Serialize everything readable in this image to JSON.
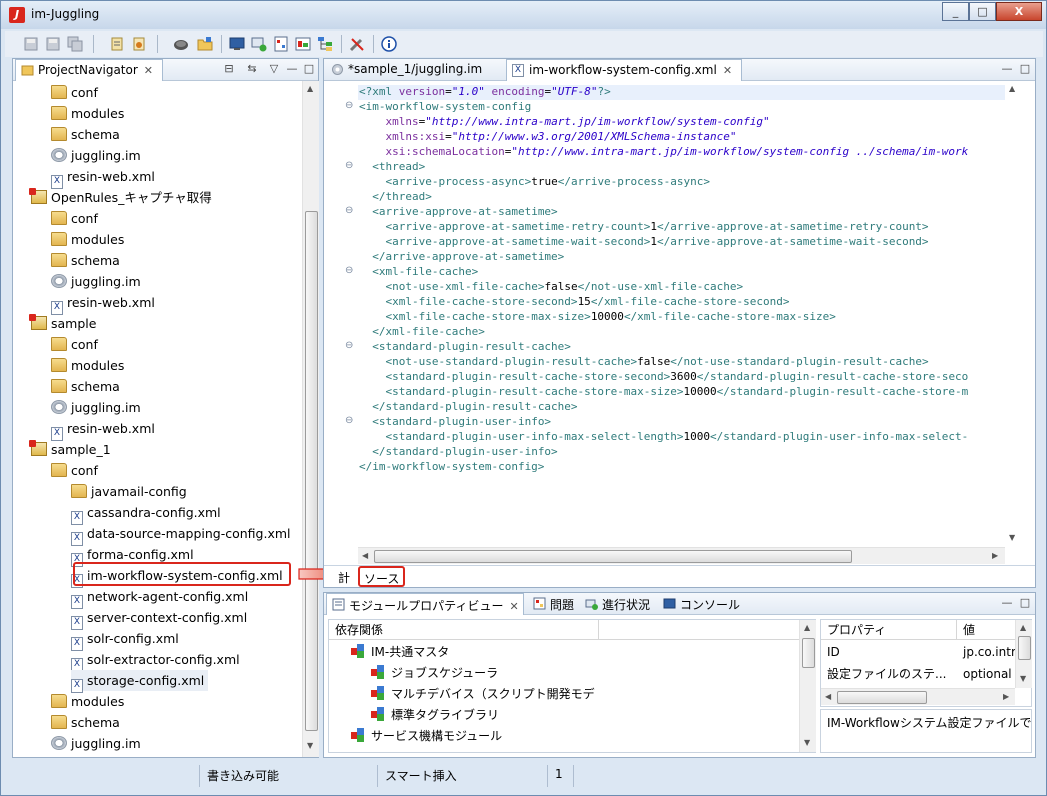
{
  "window": {
    "title": "im-Juggling",
    "buttons": [
      "_",
      "□",
      "X"
    ]
  },
  "navigator": {
    "tab_label": "ProjectNavigator",
    "rows": [
      {
        "label": "conf",
        "icon": "folder-icon"
      },
      {
        "label": "modules",
        "icon": "folder-icon"
      },
      {
        "label": "schema",
        "icon": "folder-icon"
      },
      {
        "label": "juggling.im",
        "icon": "gear-icon"
      },
      {
        "label": "resin-web.xml",
        "icon": "xml-file-icon"
      },
      {
        "label": "OpenRules_キャプチャ取得",
        "icon": "project-icon"
      },
      {
        "label": "conf",
        "icon": "folder-icon"
      },
      {
        "label": "modules",
        "icon": "folder-icon"
      },
      {
        "label": "schema",
        "icon": "folder-icon"
      },
      {
        "label": "juggling.im",
        "icon": "gear-icon"
      },
      {
        "label": "resin-web.xml",
        "icon": "xml-file-icon"
      },
      {
        "label": "sample",
        "icon": "project-icon"
      },
      {
        "label": "conf",
        "icon": "folder-icon"
      },
      {
        "label": "modules",
        "icon": "folder-icon"
      },
      {
        "label": "schema",
        "icon": "folder-icon"
      },
      {
        "label": "juggling.im",
        "icon": "gear-icon"
      },
      {
        "label": "resin-web.xml",
        "icon": "xml-file-icon"
      },
      {
        "label": "sample_1",
        "icon": "project-icon"
      },
      {
        "label": "conf",
        "icon": "folder-icon"
      },
      {
        "label": "javamail-config",
        "icon": "folder-icon"
      },
      {
        "label": "cassandra-config.xml",
        "icon": "xml-file-icon"
      },
      {
        "label": "data-source-mapping-config.xml",
        "icon": "xml-file-icon"
      },
      {
        "label": "forma-config.xml",
        "icon": "xml-file-icon"
      },
      {
        "label": "im-workflow-system-config.xml",
        "icon": "xml-file-icon"
      },
      {
        "label": "network-agent-config.xml",
        "icon": "xml-file-icon"
      },
      {
        "label": "server-context-config.xml",
        "icon": "xml-file-icon"
      },
      {
        "label": "solr-config.xml",
        "icon": "xml-file-icon"
      },
      {
        "label": "solr-extractor-config.xml",
        "icon": "xml-file-icon"
      },
      {
        "label": "storage-config.xml",
        "icon": "xml-file-icon"
      },
      {
        "label": "modules",
        "icon": "folder-icon"
      },
      {
        "label": "schema",
        "icon": "folder-icon"
      },
      {
        "label": "juggling.im",
        "icon": "gear-icon"
      }
    ]
  },
  "editor": {
    "tabs": [
      {
        "label": "*sample_1/juggling.im",
        "active": false
      },
      {
        "label": "im-workflow-system-config.xml",
        "active": true
      }
    ],
    "bottom_tabs": [
      "計",
      "ソース"
    ],
    "code_lines": [
      {
        "fold": "",
        "html": "<span class='tag'>&lt;?xml</span> <span class='attr'>version</span>=<span class='val'>\"1.0\"</span> <span class='attr'>encoding</span>=<span class='val'>\"UTF-8\"</span><span class='tag'>?&gt;</span>"
      },
      {
        "fold": "⊖",
        "html": "<span class='tag'>&lt;im-workflow-system-config</span>"
      },
      {
        "fold": "",
        "html": "    <span class='attr'>xmlns</span>=<span class='val'>\"http://www.intra-mart.jp/im-workflow/system-config\"</span>"
      },
      {
        "fold": "",
        "html": "    <span class='attr'>xmlns:xsi</span>=<span class='val'>\"http://www.w3.org/2001/XMLSchema-instance\"</span>"
      },
      {
        "fold": "",
        "html": "    <span class='attr'>xsi:schemaLocation</span>=<span class='val'>\"http://www.intra-mart.jp/im-workflow/system-config ../schema/im-work</span>"
      },
      {
        "fold": "⊖",
        "html": "  <span class='tag'>&lt;thread&gt;</span>"
      },
      {
        "fold": "",
        "html": "    <span class='tag'>&lt;arrive-process-async&gt;</span>true<span class='tag'>&lt;/arrive-process-async&gt;</span>"
      },
      {
        "fold": "",
        "html": "  <span class='tag'>&lt;/thread&gt;</span>"
      },
      {
        "fold": "⊖",
        "html": "  <span class='tag'>&lt;arrive-approve-at-sametime&gt;</span>"
      },
      {
        "fold": "",
        "html": "    <span class='tag'>&lt;arrive-approve-at-sametime-retry-count&gt;</span>1<span class='tag'>&lt;/arrive-approve-at-sametime-retry-count&gt;</span>"
      },
      {
        "fold": "",
        "html": "    <span class='tag'>&lt;arrive-approve-at-sametime-wait-second&gt;</span>1<span class='tag'>&lt;/arrive-approve-at-sametime-wait-second&gt;</span>"
      },
      {
        "fold": "",
        "html": "  <span class='tag'>&lt;/arrive-approve-at-sametime&gt;</span>"
      },
      {
        "fold": "⊖",
        "html": "  <span class='tag'>&lt;xml-file-cache&gt;</span>"
      },
      {
        "fold": "",
        "html": "    <span class='tag'>&lt;not-use-xml-file-cache&gt;</span>false<span class='tag'>&lt;/not-use-xml-file-cache&gt;</span>"
      },
      {
        "fold": "",
        "html": "    <span class='tag'>&lt;xml-file-cache-store-second&gt;</span>15<span class='tag'>&lt;/xml-file-cache-store-second&gt;</span>"
      },
      {
        "fold": "",
        "html": "    <span class='tag'>&lt;xml-file-cache-store-max-size&gt;</span>10000<span class='tag'>&lt;/xml-file-cache-store-max-size&gt;</span>"
      },
      {
        "fold": "",
        "html": "  <span class='tag'>&lt;/xml-file-cache&gt;</span>"
      },
      {
        "fold": "⊖",
        "html": "  <span class='tag'>&lt;standard-plugin-result-cache&gt;</span>"
      },
      {
        "fold": "",
        "html": "    <span class='tag'>&lt;not-use-standard-plugin-result-cache&gt;</span>false<span class='tag'>&lt;/not-use-standard-plugin-result-cache&gt;</span>"
      },
      {
        "fold": "",
        "html": "    <span class='tag'>&lt;standard-plugin-result-cache-store-second&gt;</span>3600<span class='tag'>&lt;/standard-plugin-result-cache-store-seco</span>"
      },
      {
        "fold": "",
        "html": "    <span class='tag'>&lt;standard-plugin-result-cache-store-max-size&gt;</span>10000<span class='tag'>&lt;/standard-plugin-result-cache-store-m</span>"
      },
      {
        "fold": "",
        "html": "  <span class='tag'>&lt;/standard-plugin-result-cache&gt;</span>"
      },
      {
        "fold": "⊖",
        "html": "  <span class='tag'>&lt;standard-plugin-user-info&gt;</span>"
      },
      {
        "fold": "",
        "html": "    <span class='tag'>&lt;standard-plugin-user-info-max-select-length&gt;</span>1000<span class='tag'>&lt;/standard-plugin-user-info-max-select-</span>"
      },
      {
        "fold": "",
        "html": "  <span class='tag'>&lt;/standard-plugin-user-info&gt;</span>"
      },
      {
        "fold": "",
        "html": "<span class='tag'>&lt;/im-workflow-system-config&gt;</span>"
      }
    ]
  },
  "bottom_panel": {
    "tabs": [
      "モジュールプロパティビュー",
      "問題",
      "進行状況",
      "コンソール"
    ],
    "dependency_header": "依存関係",
    "dependencies": [
      {
        "label": "IM-共通マスタ",
        "level": 0
      },
      {
        "label": "ジョブスケジューラ",
        "level": 1
      },
      {
        "label": "マルチデバイス（スクリプト開発モデ",
        "level": 1
      },
      {
        "label": "標準タグライブラリ",
        "level": 1
      },
      {
        "label": "サービス機構モジュール",
        "level": 0
      }
    ],
    "property_header": "プロパティ",
    "value_header": "値",
    "properties": [
      {
        "name": "ID",
        "value": "jp.co.intr"
      },
      {
        "name": "設定ファイルのステ...",
        "value": "optional"
      }
    ],
    "description": "IM-Workflowシステム設定ファイルで"
  },
  "status_bar": {
    "writable": "書き込み可能",
    "insert_mode": "スマート挿入",
    "line": "1"
  }
}
